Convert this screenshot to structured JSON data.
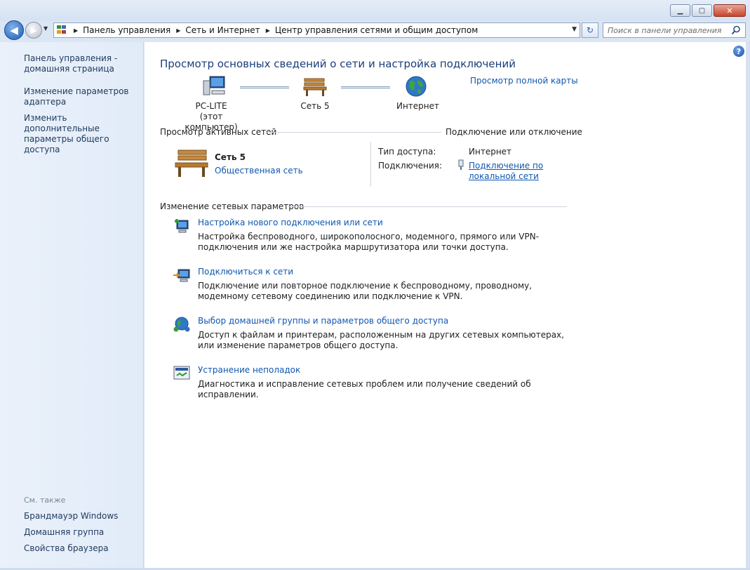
{
  "window": {
    "minimize_glyph": "▁",
    "maximize_glyph": "▢",
    "close_glyph": "✕"
  },
  "nav": {
    "back_glyph": "◀",
    "forward_glyph": "▶",
    "history_glyph": "▼",
    "refresh_glyph": "↻"
  },
  "address": {
    "crumbs": [
      "Панель управления",
      "Сеть и Интернет",
      "Центр управления сетями и общим доступом"
    ],
    "dropdown_glyph": "▼"
  },
  "search": {
    "placeholder": "Поиск в панели управления"
  },
  "sidebar": {
    "home_link": "Панель управления - домашняя страница",
    "adapter_link": "Изменение параметров адаптера",
    "sharing_link": "Изменить дополнительные параметры общего доступа",
    "see_also": "См. также",
    "see_also_links": [
      "Брандмауэр Windows",
      "Домашняя группа",
      "Свойства браузера"
    ]
  },
  "main": {
    "help_glyph": "?",
    "title": "Просмотр основных сведений о сети и настройка подключений",
    "full_map_link": "Просмотр полной карты",
    "map": {
      "computer_name": "PC-LITE",
      "computer_sub": "(этот компьютер)",
      "network_name": "Сеть  5",
      "internet_name": "Интернет"
    },
    "active_networks": {
      "heading": "Просмотр активных сетей",
      "connect_link": "Подключение или отключение",
      "network_name": "Сеть  5",
      "network_type": "Общественная сеть",
      "access_label": "Тип доступа:",
      "access_value": "Интернет",
      "connections_label": "Подключения:",
      "connection_link_line1": "Подключение по",
      "connection_link_line2": "локальной сети"
    },
    "change_settings": {
      "heading": "Изменение сетевых параметров",
      "tasks": [
        {
          "icon": "new-connection-icon",
          "title": "Настройка нового подключения или сети",
          "desc": "Настройка беспроводного, широкополосного, модемного, прямого или VPN-подключения или же настройка маршрутизатора или точки доступа."
        },
        {
          "icon": "connect-network-icon",
          "title": "Подключиться к сети",
          "desc": "Подключение или повторное подключение к беспроводному, проводному, модемному сетевому соединению или подключение к VPN."
        },
        {
          "icon": "homegroup-icon",
          "title": "Выбор домашней группы и параметров общего доступа",
          "desc": "Доступ к файлам и принтерам, расположенным на других сетевых компьютерах, или изменение параметров общего доступа."
        },
        {
          "icon": "troubleshoot-icon",
          "title": "Устранение неполадок",
          "desc": "Диагностика и исправление сетевых проблем или получение сведений об исправлении."
        }
      ]
    }
  }
}
